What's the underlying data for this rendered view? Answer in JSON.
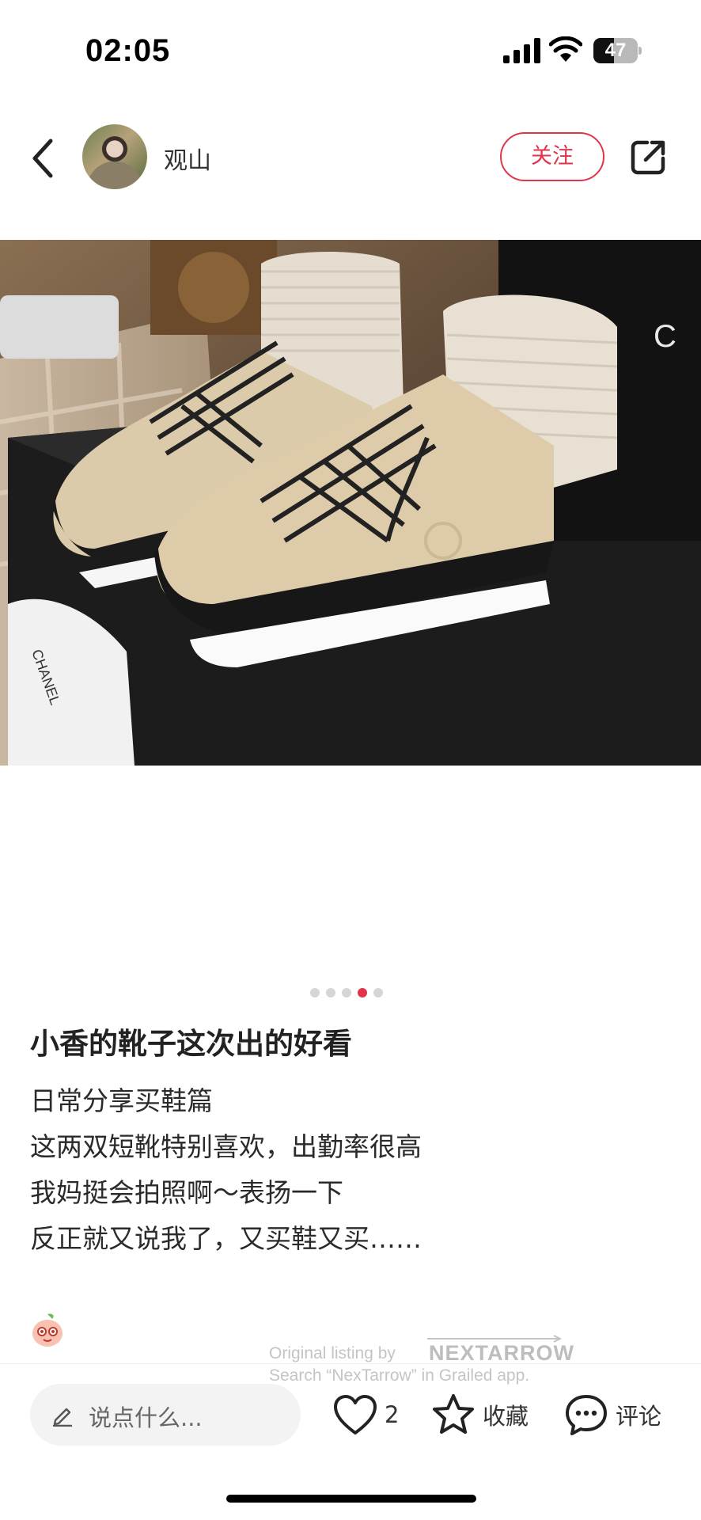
{
  "status_bar": {
    "time": "02:05",
    "battery": "47",
    "battery_level": 0.47
  },
  "header": {
    "author": "观山",
    "follow_label": "关注"
  },
  "carousel": {
    "total": 5,
    "active_index": 3
  },
  "post": {
    "title": "小香的靴子这次出的好看",
    "lines": [
      "日常分享买鞋篇",
      "这两双短靴特别喜欢，出勤率很高",
      "我妈挺会拍照啊～表扬一下",
      "反正就又说我了，又买鞋又买……"
    ]
  },
  "watermark": {
    "line1": "Original listing by",
    "brand": "NEXTARROW",
    "line2": "Search “NexTarrow” in Grailed app."
  },
  "bottom_bar": {
    "comment_placeholder": "说点什么...",
    "like_count": "2",
    "collect_label": "收藏",
    "comment_label": "评论"
  },
  "colors": {
    "accent": "#e1344a"
  },
  "icons": [
    "back-icon",
    "share-icon",
    "pencil-icon",
    "heart-icon",
    "star-icon",
    "comment-bubble-icon"
  ]
}
